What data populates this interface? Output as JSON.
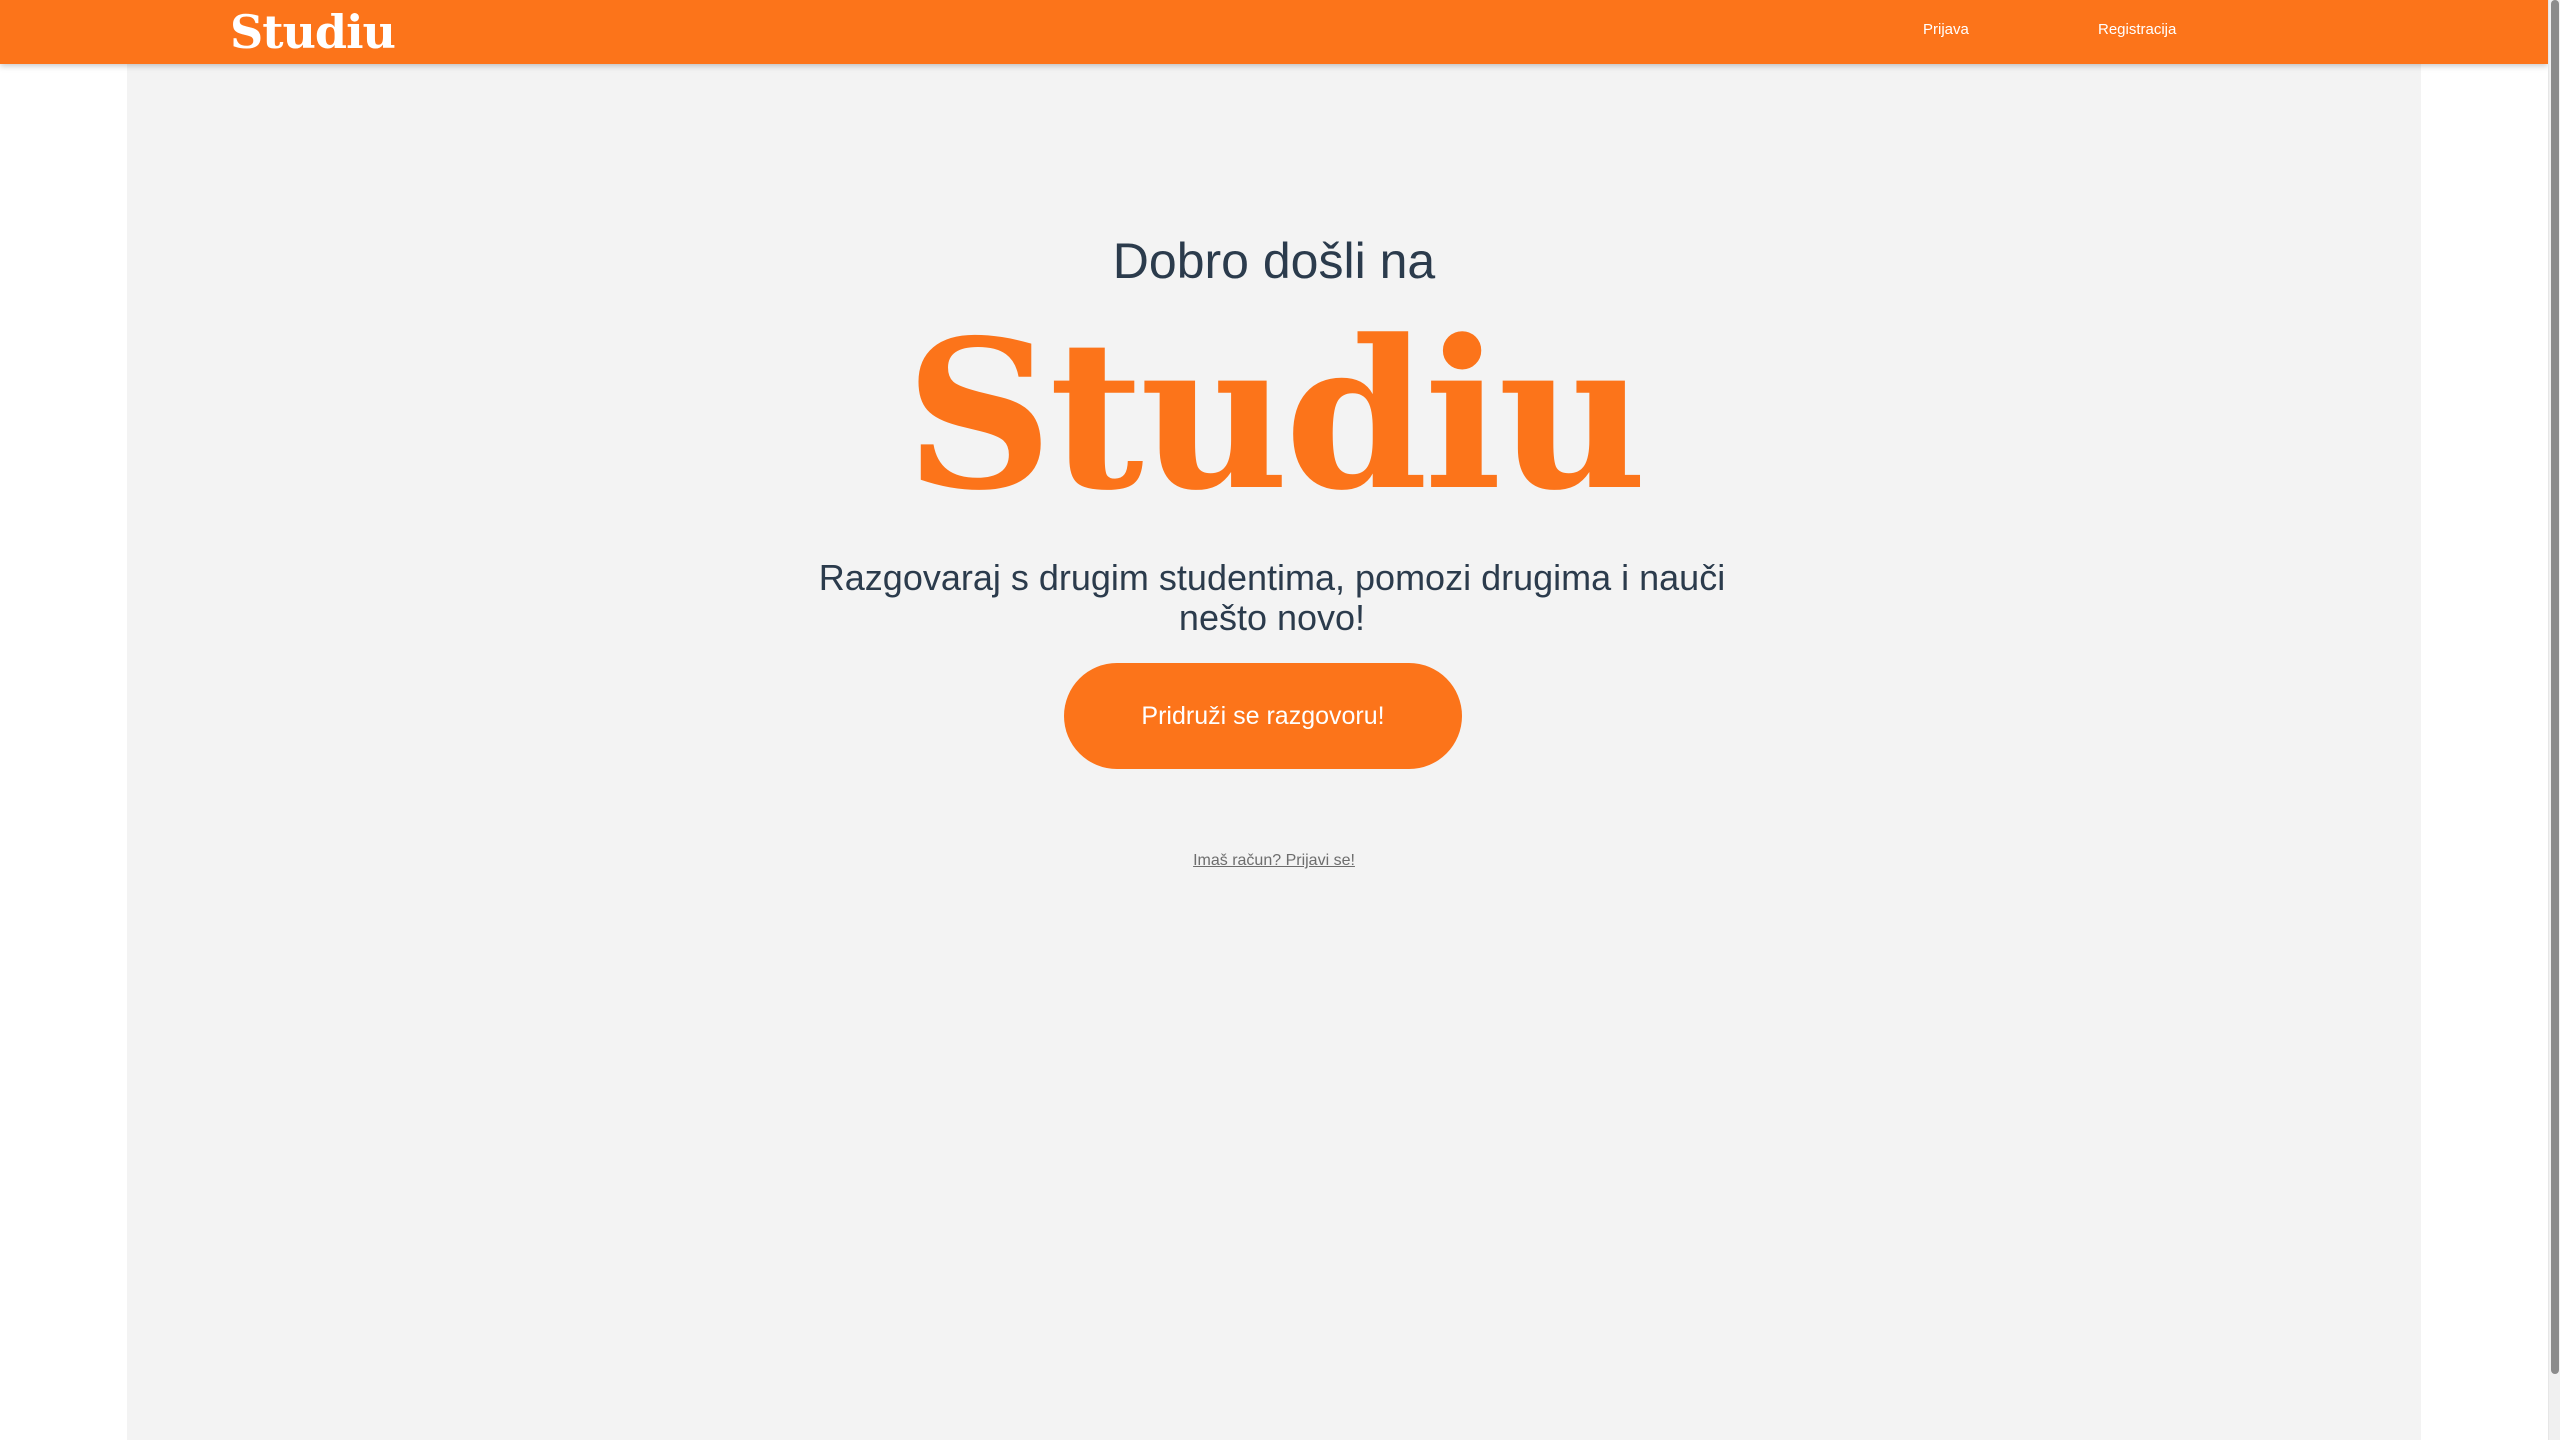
{
  "header": {
    "logo": "Studiu",
    "nav": {
      "login_label": "Prijava",
      "register_label": "Registracija"
    },
    "background_color": "#fc741a"
  },
  "hero": {
    "welcome": "Dobro došli na",
    "brand": "Studiu",
    "tagline": "Razgovaraj s drugim studentima, pomozi drugima i nauči nešto novo!",
    "cta_label": "Pridruži se razgovoru!",
    "login_prompt": "Imaš račun? Prijavi se!"
  },
  "colors": {
    "accent": "#fc741a",
    "text": "#2b3b4c",
    "panel_background": "#f3f3f3"
  }
}
